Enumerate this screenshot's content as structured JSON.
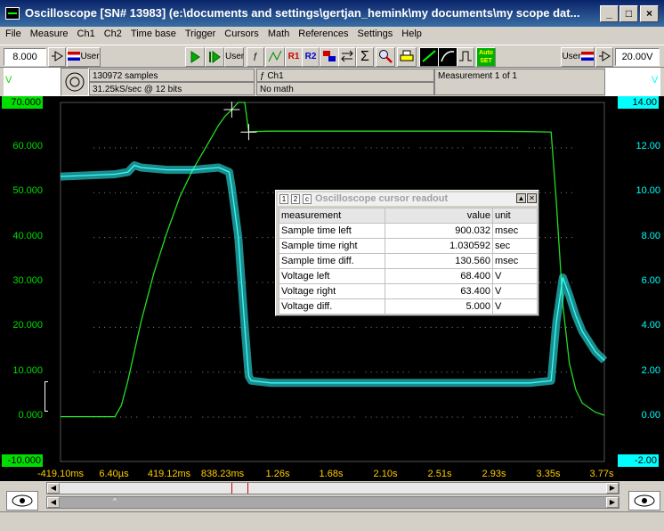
{
  "window": {
    "title": "Oscilloscope  [SN# 13983]  (e:\\documents and settings\\gertjan_hemink\\my documents\\my scope dat...",
    "min": "_",
    "max": "□",
    "close": "×"
  },
  "menu": [
    "File",
    "Measure",
    "Ch1",
    "Ch2",
    "Time base",
    "Trigger",
    "Cursors",
    "Math",
    "References",
    "Settings",
    "Help"
  ],
  "toolbar": {
    "ch1_range": "8.000",
    "ch2_range": "20.00V",
    "user_label": "User",
    "r1": "R1",
    "r2": "R2",
    "autoset": "Auto SET"
  },
  "info": {
    "samples": "130972 samples",
    "rate": "31.25kS/sec @ 12 bits",
    "channel": "ƒ Ch1",
    "math": "No math",
    "measurement": "Measurement 1 of 1"
  },
  "axes": {
    "left_unit": "V",
    "right_unit": "V",
    "left_ticks": [
      "70.000",
      "60.000",
      "50.000",
      "40.000",
      "30.000",
      "20.000",
      "10.000",
      "0.000",
      "-10.000"
    ],
    "right_ticks": [
      "14.00",
      "12.00",
      "10.00",
      "8.00",
      "6.00",
      "4.00",
      "2.00",
      "0.00",
      "-2.00"
    ],
    "x_ticks": [
      "-419.10ms",
      "6.40µs",
      "419.12ms",
      "838.23ms",
      "1.26s",
      "1.68s",
      "2.10s",
      "2.51s",
      "2.93s",
      "3.35s",
      "3.77s"
    ]
  },
  "readout": {
    "title": "Oscilloscope cursor readout",
    "tabs": [
      "1",
      "2",
      "c"
    ],
    "headers": [
      "measurement",
      "value",
      "unit"
    ],
    "rows": [
      [
        "Sample time left",
        "900.032",
        "msec"
      ],
      [
        "Sample time right",
        "1.030592",
        "sec"
      ],
      [
        "Sample time diff.",
        "130.560",
        "msec"
      ],
      [
        "Voltage left",
        "68.400",
        "V"
      ],
      [
        "Voltage right",
        "63.400",
        "V"
      ],
      [
        "Voltage diff.",
        "5.000",
        "V"
      ]
    ]
  },
  "colors": {
    "ch1": "#22dd22",
    "ch2": "#33ffff",
    "xaxis_labels": "#ffcc00",
    "background": "#000000"
  },
  "chart_data": {
    "type": "line",
    "xlim": [
      -0.4191,
      3.77
    ],
    "ylim_left": [
      -10,
      70
    ],
    "ylim_right": [
      -2,
      14
    ],
    "grid": true,
    "series": [
      {
        "name": "Ch1",
        "axis": "left",
        "x": [
          -0.4191,
          0.0,
          0.05,
          0.1,
          0.2,
          0.3,
          0.4,
          0.5,
          0.6,
          0.7,
          0.8,
          0.85,
          0.9,
          0.95,
          1.0,
          1.03,
          1.05,
          1.2,
          1.6,
          2.0,
          2.4,
          2.8,
          3.2,
          3.36,
          3.4,
          3.45,
          3.5,
          3.55,
          3.6,
          3.7,
          3.77
        ],
        "values": [
          0,
          0,
          2.5,
          8,
          21,
          32,
          41,
          49,
          55,
          60,
          65,
          67,
          68.4,
          70,
          70,
          63.4,
          63.5,
          63.6,
          63.6,
          63.6,
          63.6,
          63.6,
          63.5,
          63.4,
          48,
          25,
          12,
          6,
          3,
          1,
          0.3
        ]
      },
      {
        "name": "Ch2",
        "axis": "right",
        "x": [
          -0.4191,
          0.0,
          0.1,
          0.15,
          0.2,
          0.4,
          0.6,
          0.8,
          0.88,
          0.9,
          0.95,
          1.0,
          1.03,
          1.05,
          1.2,
          1.6,
          2.0,
          2.4,
          2.8,
          3.2,
          3.36,
          3.4,
          3.45,
          3.5,
          3.55,
          3.6,
          3.7,
          3.77
        ],
        "values": [
          10.7,
          10.8,
          10.9,
          11.2,
          11.1,
          11.0,
          11.0,
          11.1,
          10.9,
          10.2,
          8.0,
          4.0,
          1.8,
          1.6,
          1.5,
          1.5,
          1.5,
          1.5,
          1.5,
          1.5,
          1.6,
          4.2,
          6.2,
          5.4,
          4.5,
          3.8,
          2.9,
          2.5
        ]
      }
    ],
    "cursors": [
      0.9,
      1.0306
    ]
  }
}
